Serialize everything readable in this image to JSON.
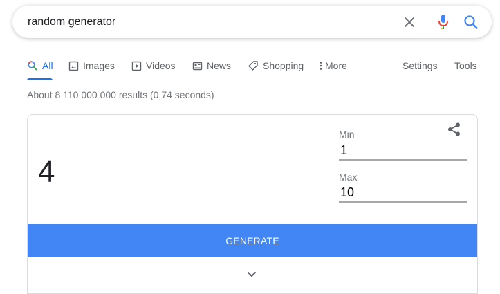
{
  "search": {
    "query": "random generator"
  },
  "tabs": [
    {
      "label": "All",
      "icon": "search-icon"
    },
    {
      "label": "Images",
      "icon": "image-icon"
    },
    {
      "label": "Videos",
      "icon": "play-icon"
    },
    {
      "label": "News",
      "icon": "news-icon"
    },
    {
      "label": "Shopping",
      "icon": "tag-icon"
    },
    {
      "label": "More",
      "icon": "more-vert-icon"
    }
  ],
  "tools": {
    "settings": "Settings",
    "tools": "Tools"
  },
  "results": {
    "stats": "About 8 110 000 000 results (0,74 seconds)"
  },
  "generator": {
    "result": "4",
    "min_label": "Min",
    "min_value": "1",
    "max_label": "Max",
    "max_value": "10",
    "generate_label": "GENERATE"
  },
  "colors": {
    "accent": "#1a73e8",
    "button": "#4285f4"
  }
}
